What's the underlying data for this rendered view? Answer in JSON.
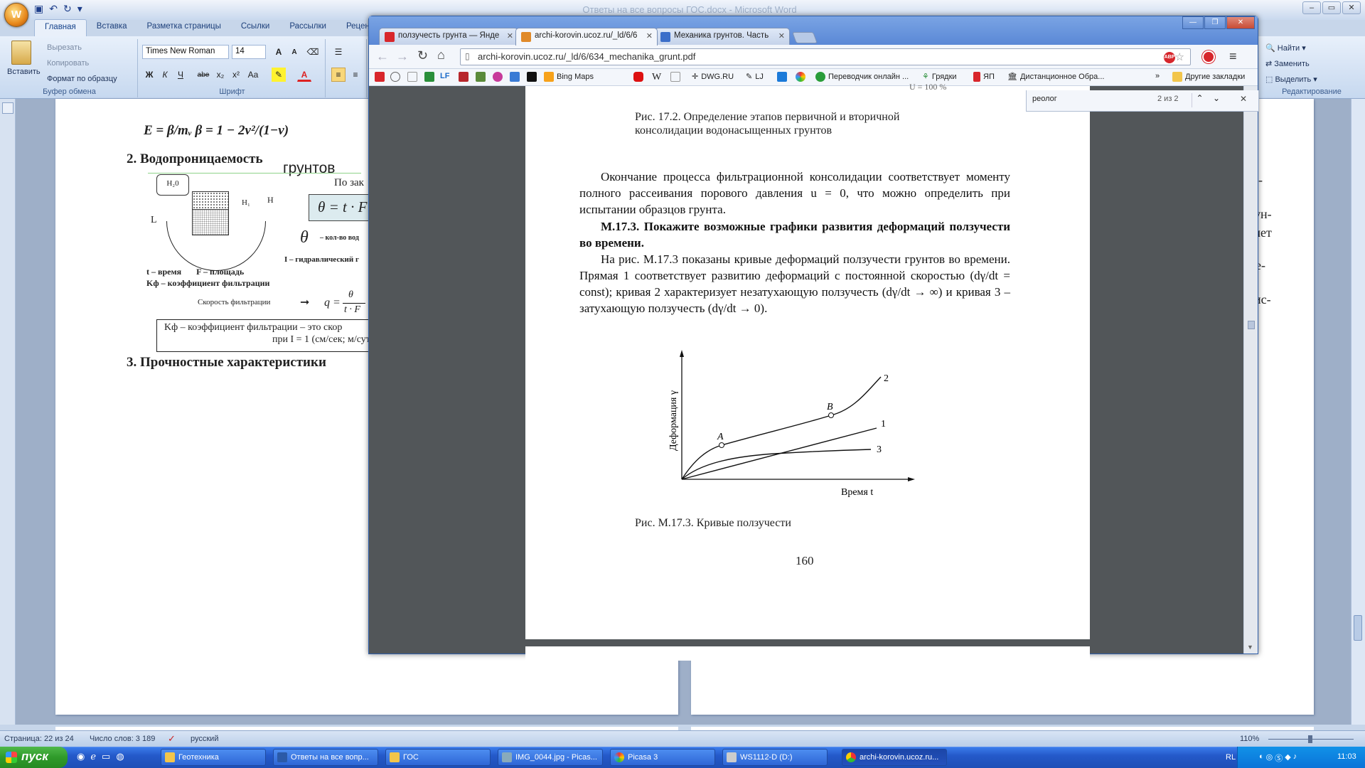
{
  "word": {
    "title": "Ответы на все вопросы ГОС.docx - Microsoft Word",
    "office_button": "W",
    "ribbon_tabs": [
      "Главная",
      "Вставка",
      "Разметка страницы",
      "Ссылки",
      "Рассылки",
      "Реценз"
    ],
    "clipboard": {
      "paste": "Вставить",
      "cut": "Вырезать",
      "copy": "Копировать",
      "format_painter": "Формат по образцу",
      "group": "Буфер обмена"
    },
    "font": {
      "name": "Times New Roman",
      "size": "14",
      "group": "Шрифт",
      "bold": "Ж",
      "italic": "К",
      "underline": "Ч",
      "strike": "abe",
      "sub": "x₂",
      "sup": "x²",
      "case": "Aa"
    },
    "editing": {
      "find": "Найти",
      "replace": "Заменить",
      "select": "Выделить",
      "group": "Редактирование"
    },
    "doc": {
      "formula": "E = β/mᵥ  β = 1 − 2v²/(1−v)",
      "heading2": "2.  Водопроницаемость",
      "overlap_title": "грунтов",
      "law_caption": "По зак",
      "theta_formula": "θ = t · F",
      "theta_label": "– кол-во вод",
      "h2o": "H₂0",
      "label_L": "L",
      "label_H": "H",
      "label_H1": "H₁",
      "hydraulic": "I – гидравлический г",
      "time_area": "t – время       F – площадь",
      "kf_line": "Kф – коэффициент фильтрации",
      "speed_label": "Скорость фильтрации",
      "speed_formula_q": "q =",
      "speed_formula_num": "θ",
      "speed_formula_den": "t · F",
      "box_line1": "Kф – коэффициент фильтрации – это скор",
      "box_line2": "при I = 1 (см/сек; м/сут)",
      "heading3": "3.  Прочностные характеристики",
      "right_fragments": [
        "-",
        "ун-",
        "чет",
        "е-",
        "ис-"
      ]
    },
    "status": {
      "page": "Страница: 22 из 24",
      "words": "Число слов: 3 189",
      "lang": "русский",
      "zoom": "110%"
    }
  },
  "chrome": {
    "tabs": [
      {
        "title": "ползучесть грунта — Янде",
        "color": "#d8262b"
      },
      {
        "title": "archi-korovin.ucoz.ru/_ld/6/6",
        "color": "#e08a2a"
      },
      {
        "title": "Механика грунтов. Часть",
        "color": "#3b6ec9"
      }
    ],
    "url": "archi-korovin.ucoz.ru/_ld/6/634_mechanika_grunt.pdf",
    "bookmarks": [
      "LF",
      "Bing Maps",
      "W",
      "DWG.RU",
      "LJ",
      "Переводчик онлайн ...",
      "Грядки",
      "ЯП",
      "Дистанционное Обра...",
      "Другие закладки"
    ],
    "find": {
      "query": "реолог",
      "count": "2 из 2"
    },
    "pdf": {
      "top_fragment": "U = 100 %",
      "fig_caption_1": "Рис. 17.2. Определение этапов первичной и вторичной",
      "fig_caption_2": "консолидации водонасыщенных грунтов",
      "para1": "Окончание процесса фильтрационной консолидации соответствует моменту полного рассеивания порового давления u = 0, что можно определить при испытании образцов грунта.",
      "question": "М.17.3. Покажите возможные графики развития деформаций ползучести во времени.",
      "para2": "На рис. М.17.3 показаны кривые деформаций ползучести грунтов во времени. Прямая 1 соответствует развитию деформаций с постоянной скоростью (dγ/dt = const); кривая 2 характеризует незатухающую ползучесть (dγ/dt → ∞) и кривая 3 – затухающую ползучесть (dγ/dt → 0).",
      "chart_ylabel": "Деформация γ",
      "chart_xlabel": "Время t",
      "point_a": "A",
      "point_b": "B",
      "curve_labels": [
        "2",
        "1",
        "3"
      ],
      "fig_caption_3": "Рис. М.17.3. Кривые ползучести",
      "page_number": "160"
    }
  },
  "taskbar": {
    "start": "пуск",
    "items": [
      "Геотехника",
      "Ответы на все вопр...",
      "ГОС",
      "IMG_0044.jpg - Picas...",
      "Picasa 3",
      "WS1112-D (D:)",
      "archi-korovin.ucoz.ru..."
    ],
    "lang": "RL",
    "clock": "11:03"
  }
}
